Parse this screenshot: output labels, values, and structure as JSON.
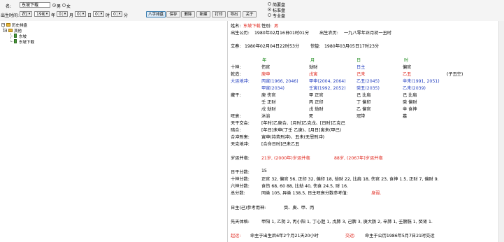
{
  "toolbar": {
    "name_label": "名:",
    "name_value": "东坡下载",
    "gender_male": "男",
    "gender_female": "女",
    "birth_label": "出生时间:",
    "calendar_value": "农历",
    "year_value": "1980",
    "year_unit": "年",
    "month_value": "01",
    "month_unit": "月",
    "day_value": "01",
    "day_unit": "日",
    "hour_value": "01",
    "hour_unit": "时",
    "minute_value": "01",
    "minute_unit": "分",
    "buttons": [
      "八字排盘",
      "保存",
      "删除",
      "新建",
      "打印",
      "导出",
      "关于"
    ],
    "options": [
      "简要盘",
      "标准盘",
      "专业盘"
    ]
  },
  "tree": {
    "root": "历史排盘",
    "group": "其他",
    "items": [
      "东坡",
      "东坡下载"
    ]
  },
  "chart": {
    "name_label": "姓名:",
    "name": "东坡下载",
    "gender_label": "性别:",
    "gender": "男",
    "solar_label": "出生公历:",
    "solar": "1980年02月16日01时01分",
    "lunar_label": "出生农历:",
    "lunar": "一九八零年正月初一丑时",
    "lichun_label": "立春:",
    "lichun": "1980年02月04日22时53分",
    "jingzhe_label": "惊蛰:",
    "jingzhe": "1980年03月05日17时23分",
    "pillar_headers": [
      "年",
      "月",
      "日",
      "时"
    ],
    "rows": [
      {
        "label": "十神:",
        "cells": [
          "伤官",
          "劫财",
          "日主",
          "偏官"
        ]
      },
      {
        "label": "乾造:",
        "cells": [
          "庚申",
          "戊寅",
          "己未",
          "乙丑"
        ],
        "extra": "(子丑空)"
      },
      {
        "label": "大运地冲:",
        "cells": [
          "丙寅(1966, 2046)",
          "甲申(2004, 2064)",
          "乙丑(2045)",
          "辛未(1991, 2051)"
        ]
      },
      {
        "label": "",
        "cells": [
          "甲寅(2034)",
          "壬寅(1992, 2052)",
          "癸丑(2035)",
          "乙未(2039)"
        ]
      }
    ],
    "canggan_label": "藏干:",
    "canggan": [
      [
        "庚 伤官",
        "甲 正官",
        "己 比肩",
        "己 比肩"
      ],
      [
        "壬 正财",
        "丙 正印",
        "丁 偏印",
        "癸 偏财"
      ],
      [
        "戊 劫财",
        "戊 劫财",
        "乙 偏官",
        "辛 食神"
      ]
    ],
    "wangshuai_label": "旺衰:",
    "wangshuai": [
      "沐浴",
      "死",
      "冠带",
      "墓"
    ],
    "tianganhe_label": "天干交会:",
    "tianganhe": "[年时]乙庚合、[月时]乙克戊、[日时]乙克己",
    "anhe_label": "暗合:",
    "anhe": "[年日]未申(丁壬 乙庚)、[月日]寅未(甲己)",
    "hexing_label": "合冲刑害:",
    "hexing": "寅申(持势刑冲)、丑未(无恩刑冲)",
    "tianyun_label": "天克地冲:",
    "tianyun": "[合命日时]己未乙丑",
    "qiyun_label": "岁运并临:",
    "qiyun": [
      "21岁, (2000年)岁运并临",
      "88岁, (2067年)岁运并临"
    ],
    "score_label": "日干分数:",
    "score": "15",
    "shishen_label": "十神分数:",
    "shishen": "正官 32, 偏官 56, 正印 32, 偏印 18, 劫财 22, 比肩 18, 伤官 23, 食神 1.5, 正财 7, 偏财 9.",
    "liuhe_label": "六神分数:",
    "liuhe": "食伤 68, 60 88, 比劫 40, 伤食 24.5, 财 16.",
    "total_label": "总分数:",
    "total": "同类 105, 异类 138.5, 日主旺衰分数参考值:",
    "total_result": "身弱.",
    "yongshen_label": "日主(己)参考用神:",
    "yongshen": "癸、庚、甲、丙",
    "xiantian_label": "先天体格:",
    "xiantian": "甲阳 1, 乙阴 2, 丙小阳 1, 丁心胆 1, 戊肺 3, 己脾 3, 庚大肠 2, 辛肺 1, 壬膀胱 1, 癸肾 1.",
    "qiyun2_label": "起运:",
    "qiyun2": "命主于出生后6年2个月21天20小时",
    "jiaoyun_label": "交运:",
    "jiaoyun": "命主于公历1986年5月7日21时交运"
  }
}
